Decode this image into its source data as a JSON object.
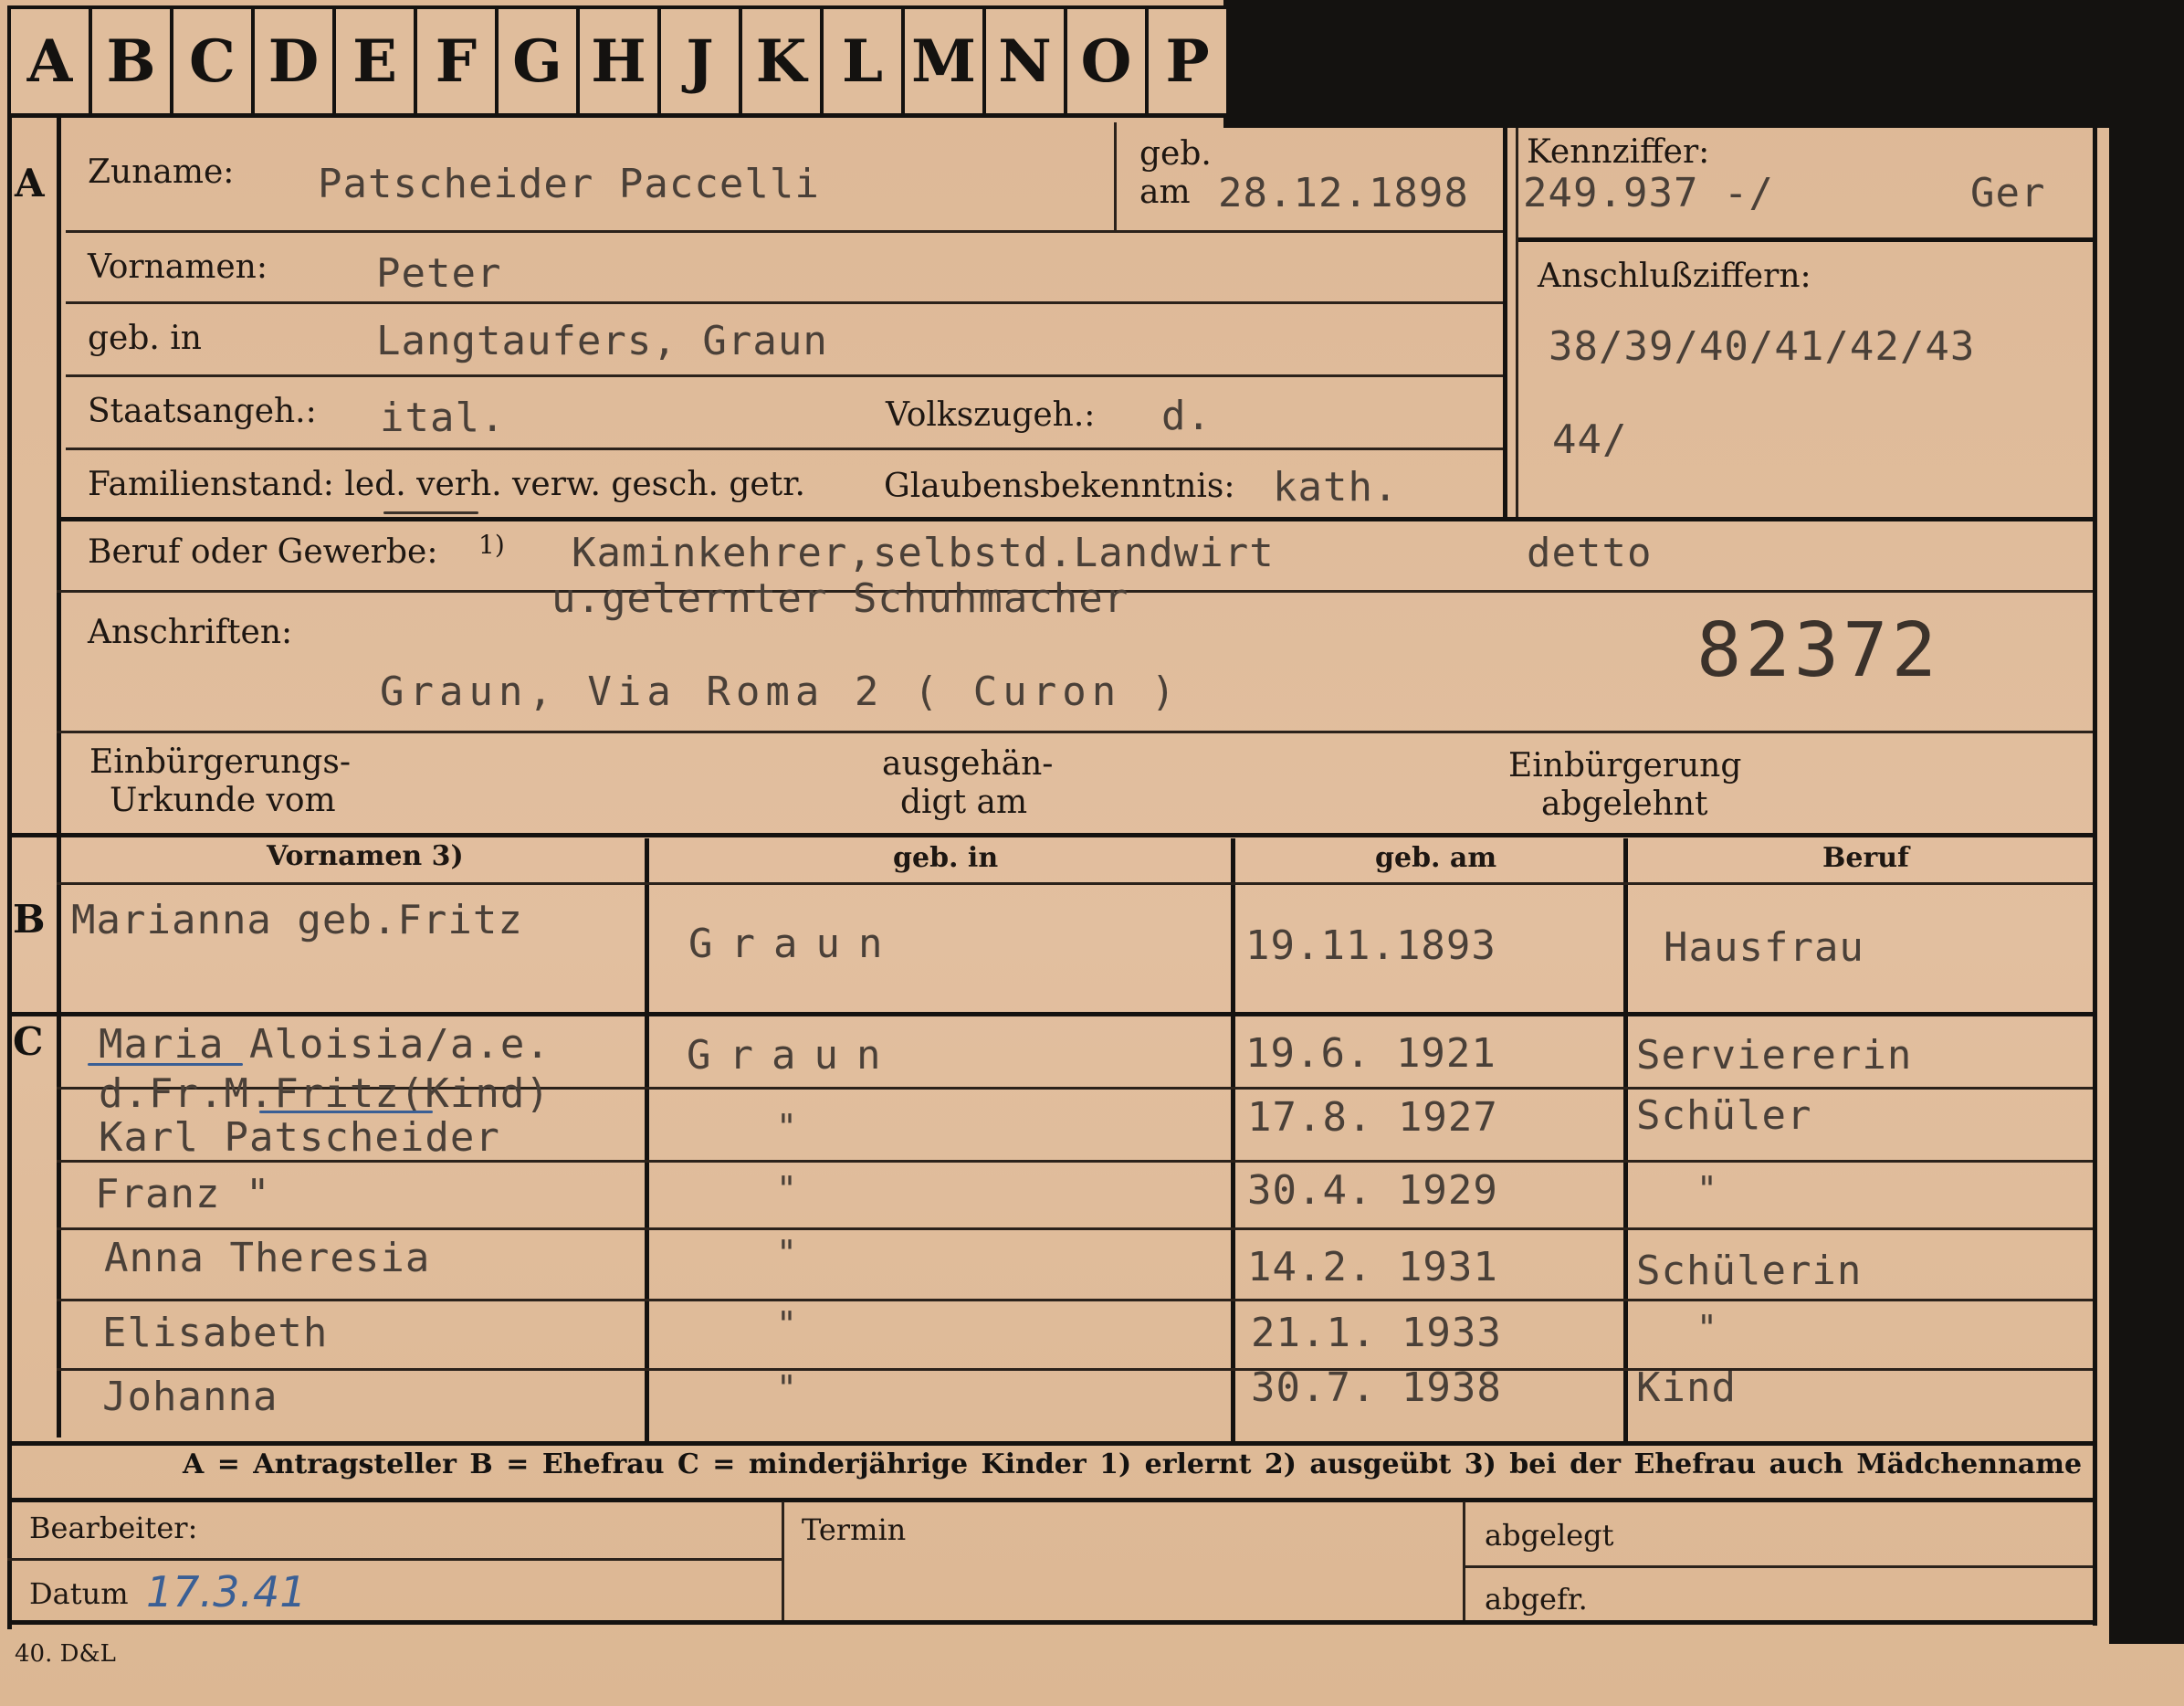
{
  "index_tabs": [
    "A",
    "B",
    "C",
    "D",
    "E",
    "F",
    "G",
    "H",
    "J",
    "K",
    "L",
    "M",
    "N",
    "O",
    "P"
  ],
  "section_markers": {
    "applicant": "A",
    "spouse": "B",
    "children": "C"
  },
  "applicant": {
    "surname_label": "Zuname:",
    "surname": "Patscheider Paccelli",
    "born_label_1": "geb.",
    "born_label_2": "am",
    "born_date": "28.12.1898",
    "ref_label": "Kennziffer:",
    "ref_number": "249.937 -/",
    "ref_suffix": "Ger",
    "firstnames_label": "Vornamen:",
    "firstnames": "Peter",
    "birthplace_label": "geb. in",
    "birthplace": "Langtaufers, Graun",
    "linked_label": "Anschlußziffern:",
    "linked_numbers_1": "38/39/40/41/42/43",
    "linked_numbers_2": "44/",
    "citizenship_label": "Staatsangeh.:",
    "citizenship": "ital.",
    "ethnicity_label": "Volkszugeh.:",
    "ethnicity": "d.",
    "marital_label": "Familienstand: led. verh. verw. gesch. getr.",
    "religion_label": "Glaubensbekenntnis:",
    "religion": "kath.",
    "occupation_label": "Beruf oder Gewerbe:",
    "occupation_footnote": "1)",
    "occupation_1": "Kaminkehrer,selbstd.Landwirt",
    "occupation_2": "u.gelernter Schuhmacher",
    "occupation_practised": "detto",
    "address_label": "Anschriften:",
    "address": "Graun, Via Roma 2 ( Curon )",
    "stamp_number": "82372",
    "naturalisation_label_1": "Einbürgerungs-",
    "naturalisation_label_2": "Urkunde vom",
    "handed_label_1": "ausgehän-",
    "handed_label_2": "digt am",
    "refused_label_1": "Einbürgerung",
    "refused_label_2": "abgelehnt"
  },
  "family_table": {
    "headers": [
      "Vornamen 3)",
      "geb. in",
      "geb. am",
      "Beruf"
    ],
    "spouse": {
      "name": "Marianna geb.Fritz",
      "place": "Graun",
      "date": "19.11.1893",
      "occupation": "Hausfrau"
    },
    "children": [
      {
        "name": "Maria Aloisia/a.e.",
        "place": "Graun",
        "date": "19.6. 1921",
        "occupation": "Serviererin"
      },
      {
        "name": "d.Fr.M.Fritz(Kind)",
        "place": "",
        "date": "",
        "occupation": ""
      },
      {
        "name": "Karl Patscheider",
        "place": "\"",
        "date": "17.8. 1927",
        "occupation": "Schüler"
      },
      {
        "name": "Franz       \"",
        "place": "\"",
        "date": "30.4. 1929",
        "occupation": "\""
      },
      {
        "name": "Anna Theresia",
        "place": "\"",
        "date": "14.2. 1931",
        "occupation": "Schülerin"
      },
      {
        "name": "Elisabeth",
        "place": "\"",
        "date": "21.1. 1933",
        "occupation": "\""
      },
      {
        "name": "Johanna",
        "place": "\"",
        "date": "30.7. 1938",
        "occupation": "Kind"
      }
    ]
  },
  "legend": "A = Antragsteller   B = Ehefrau   C = minderjährige Kinder   1) erlernt   2) ausgeübt   3) bei der Ehefrau auch Mädchenname",
  "footer": {
    "clerk_label": "Bearbeiter:",
    "date_label": "Datum",
    "date_value": "17.3.41",
    "deadline_label": "Termin",
    "filed_label": "abgelegt",
    "dispatched_label": "abgefr.",
    "form_code": "40. D&L"
  }
}
